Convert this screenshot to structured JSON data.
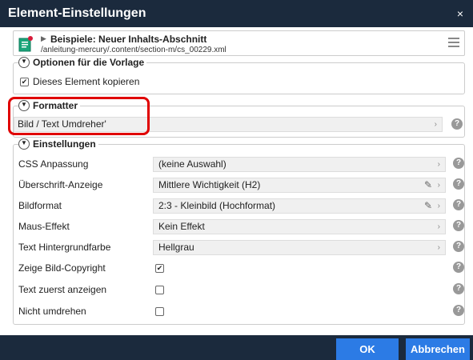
{
  "dialog": {
    "title": "Element-Einstellungen",
    "close": "×"
  },
  "resource": {
    "title": "Beispiele: Neuer Inhalts-Abschnitt",
    "path": "/anleitung-mercury/.content/section-m/cs_00229.xml"
  },
  "options": {
    "legend": "Optionen für die Vorlage",
    "copy_label": "Dieses Element kopieren",
    "copy_checked": true
  },
  "formatter": {
    "legend": "Formatter",
    "value": "Bild / Text Umdreher'"
  },
  "settings": {
    "legend": "Einstellungen",
    "rows": [
      {
        "label": "CSS Anpassung",
        "value": "(keine Auswahl)",
        "type": "select",
        "pencil": false
      },
      {
        "label": "Überschrift-Anzeige",
        "value": "Mittlere Wichtigkeit (H2)",
        "type": "select",
        "pencil": true
      },
      {
        "label": "Bildformat",
        "value": "2:3 - Kleinbild (Hochformat)",
        "type": "select",
        "pencil": true
      },
      {
        "label": "Maus-Effekt",
        "value": "Kein Effekt",
        "type": "select",
        "pencil": false
      },
      {
        "label": "Text Hintergrundfarbe",
        "value": "Hellgrau",
        "type": "select",
        "pencil": false
      },
      {
        "label": "Zeige Bild-Copyright",
        "checked": true,
        "type": "checkbox"
      },
      {
        "label": "Text zuerst anzeigen",
        "checked": false,
        "type": "checkbox"
      },
      {
        "label": "Nicht umdrehen",
        "checked": false,
        "type": "checkbox"
      }
    ]
  },
  "buttons": {
    "ok": "OK",
    "cancel": "Abbrechen"
  },
  "colors": {
    "header": "#1b2a3d",
    "button": "#2c7be5",
    "highlight": "#e00000"
  },
  "icons": {
    "resource": "content-section-icon",
    "menu": "menu-icon",
    "help": "help-icon",
    "edit": "pencil-icon",
    "toggle": "collapse-toggle-icon"
  }
}
